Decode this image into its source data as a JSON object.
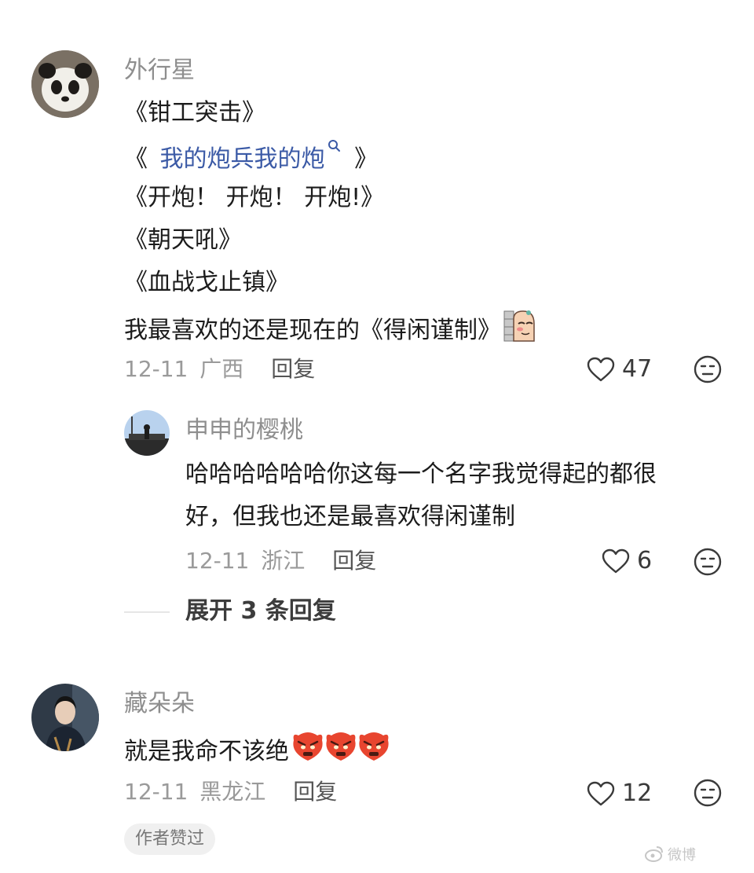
{
  "comments": [
    {
      "username": "外行星",
      "lines": [
        "《钳工突击》",
        "《",
        "我的炮兵我的炮",
        "》",
        "《开炮！ 开炮！ 开炮!》",
        "《朝天吼》",
        "《血战戈止镇》",
        "我最喜欢的还是现在的《得闲谨制》"
      ],
      "date": "12-11",
      "location": "广西",
      "reply_label": "回复",
      "likes": "47",
      "colors": {
        "link": "#3b5aa6"
      }
    },
    {
      "username": "申申的樱桃",
      "lines": [
        "哈哈哈哈哈哈你这每一个名字我觉得起的都很",
        "好，但我也还是最喜欢得闲谨制"
      ],
      "date": "12-11",
      "location": "浙江",
      "reply_label": "回复",
      "likes": "6"
    },
    {
      "username": "藏朵朵",
      "lines": [
        "就是我命不该绝"
      ],
      "date": "12-11",
      "location": "黑龙江",
      "reply_label": "回复",
      "likes": "12",
      "badge": "作者赞过"
    }
  ],
  "expand_replies": "展开 3 条回复",
  "watermark": "微博"
}
